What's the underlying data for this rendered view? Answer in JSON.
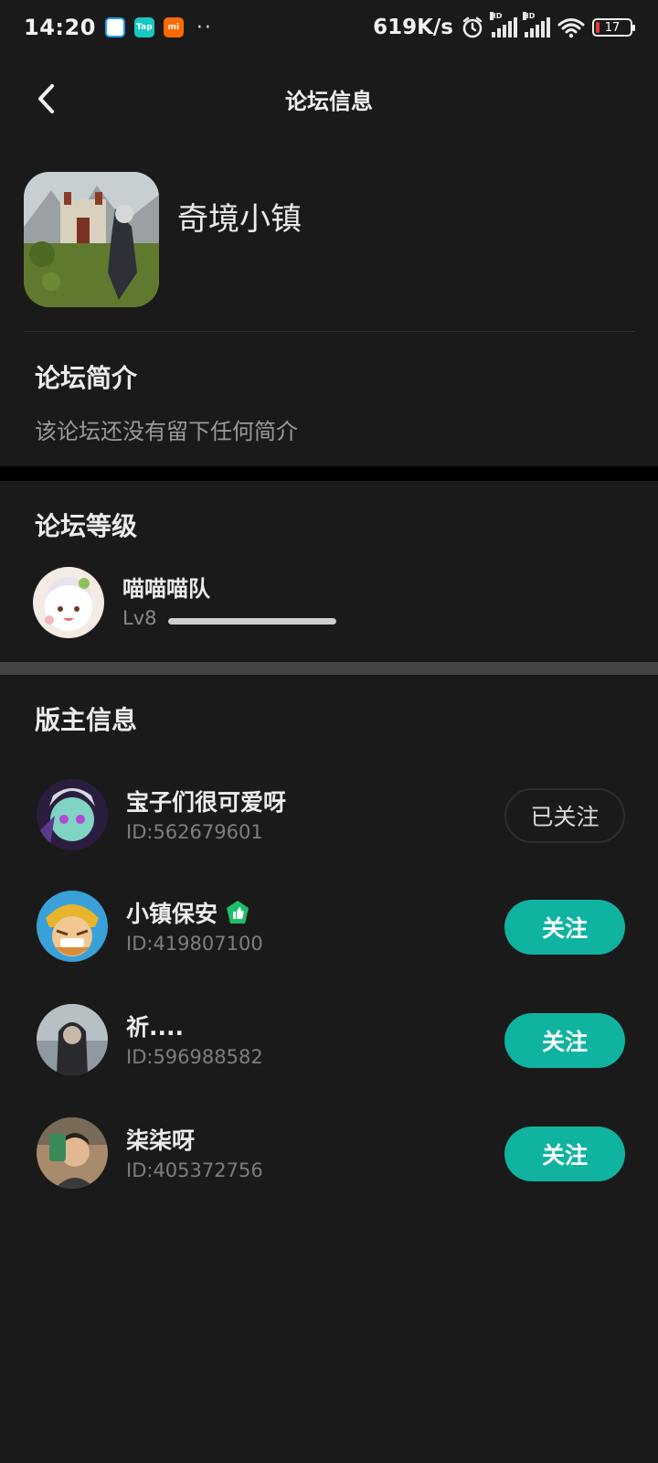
{
  "status_bar": {
    "time": "14:20",
    "app_icons": [
      "home-app-icon",
      "tap-app-icon",
      "mi-app-icon"
    ],
    "app_icon_labels": [
      "",
      "Tap",
      "mi"
    ],
    "more": "··",
    "speed": "619K/s",
    "signal_label": "HD",
    "battery": "17",
    "battery_color": "#e53935"
  },
  "header": {
    "title": "论坛信息",
    "back_icon": "chevron-left-icon"
  },
  "forum": {
    "name": "奇境小镇"
  },
  "intro": {
    "title": "论坛简介",
    "text": "该论坛还没有留下任何简介"
  },
  "level": {
    "title": "论坛等级",
    "team_name": "喵喵喵队",
    "level_label": "Lv8",
    "progress": 1.0
  },
  "moderators": {
    "title": "版主信息",
    "items": [
      {
        "name": "宝子们很可爱呀",
        "id": "ID:562679601",
        "button": "已关注",
        "followed": true,
        "badge": ""
      },
      {
        "name": "小镇保安",
        "id": "ID:419807100",
        "button": "关注",
        "followed": false,
        "badge": "thumbs-up-badge-icon"
      },
      {
        "name": "祈....",
        "id": "ID:596988582",
        "button": "关注",
        "followed": false,
        "badge": ""
      },
      {
        "name": "柒柒呀",
        "id": "ID:405372756",
        "button": "关注",
        "followed": false,
        "badge": ""
      }
    ]
  },
  "colors": {
    "background": "#1a1a1a",
    "accent": "#10b3a0",
    "badge_green": "#1fbf6a"
  }
}
